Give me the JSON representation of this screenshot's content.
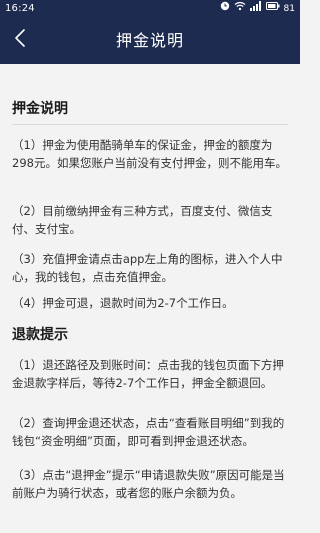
{
  "status_bar": {
    "time": "16:24",
    "icons": [
      "clock-icon",
      "wifi-icon",
      "signal-icon",
      "battery-icon"
    ],
    "battery_text": "81"
  },
  "nav": {
    "title": "押金说明",
    "back_icon": "chevron-left-icon"
  },
  "deposit": {
    "title": "押金说明",
    "items": [
      "（1）押金为使用酷骑单车的保证金，押金的额度为298元。如果您账户当前没有支付押金，则不能用车。",
      "（2）目前缴纳押金有三种方式，百度支付、微信支付、支付宝。",
      "（3）充值押金请点击app左上角的图标，进入个人中心，我的钱包，点击充值押金。",
      "（4）押金可退，退款时间为2-7个工作日。"
    ]
  },
  "refund": {
    "title": "退款提示",
    "items": [
      "（1）退还路径及到账时间：点击我的钱包页面下方押金退款字样后，等待2-7个工作日，押金全额退回。",
      "（2）查询押金退还状态，点击“查看账目明细”到我的钱包“资金明细”页面，即可看到押金退还状态。",
      "（3）点击“退押金”提示“申请退款失败”原因可能是当前账户为骑行状态，或者您的账户余额为负。"
    ]
  },
  "colors": {
    "header": "#1e2b50",
    "background": "#f3f3f3",
    "text": "#333333"
  }
}
